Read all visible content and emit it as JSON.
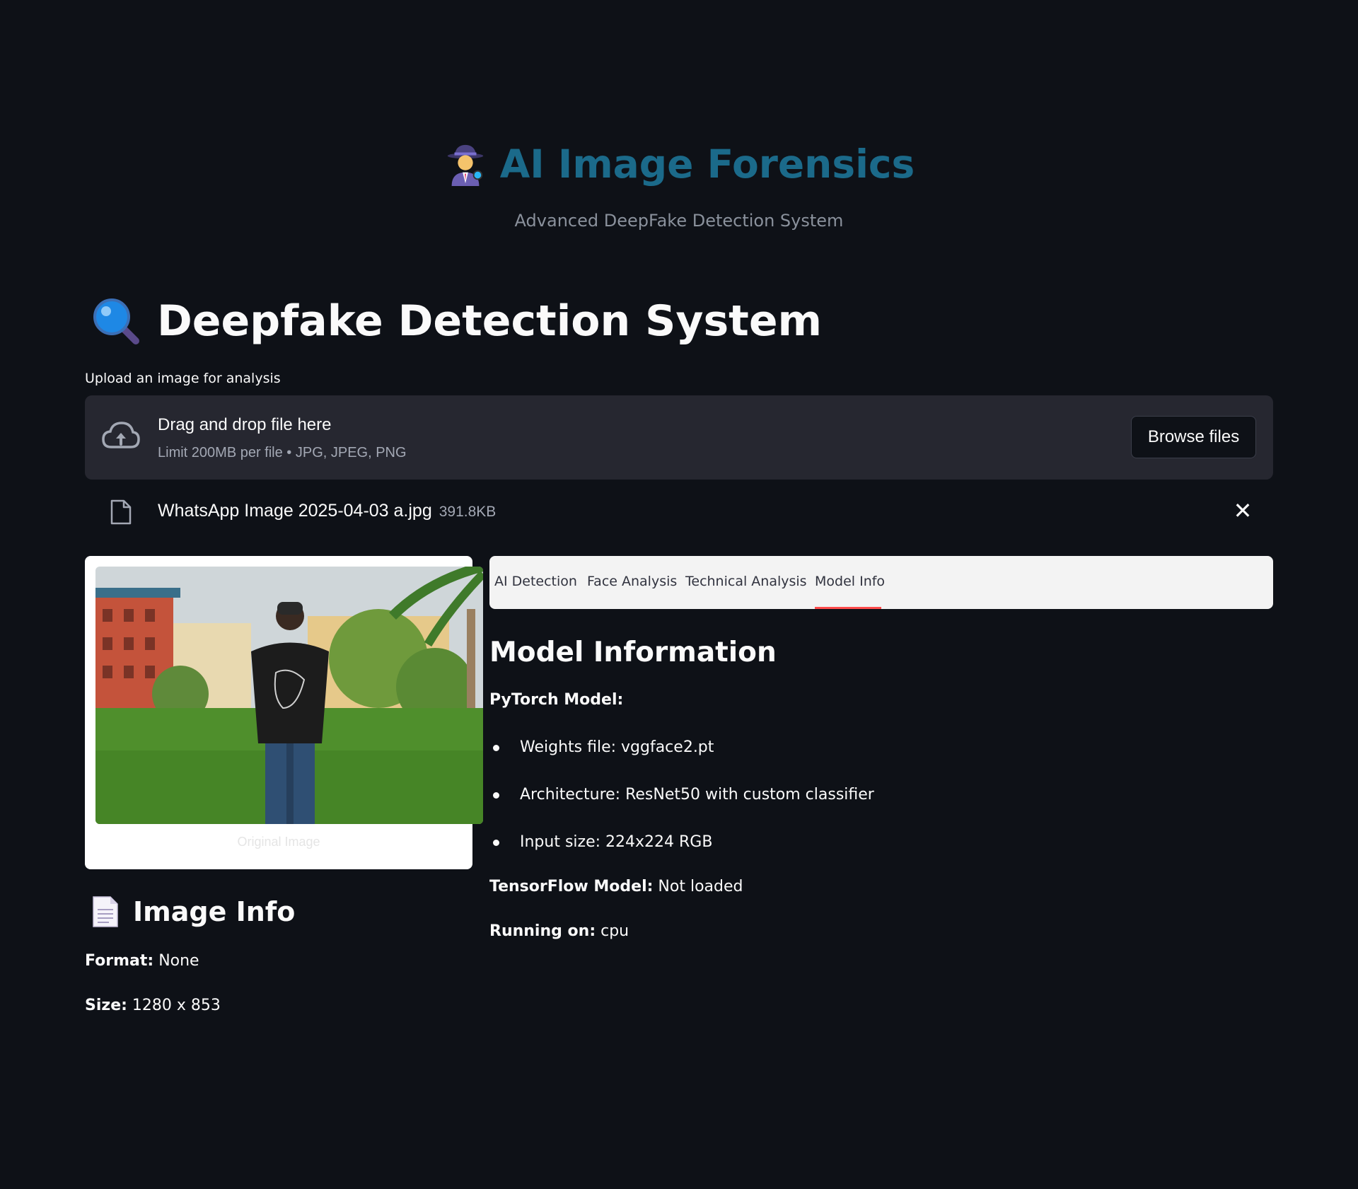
{
  "header": {
    "title": "AI Image Forensics",
    "subtitle": "Advanced DeepFake Detection System"
  },
  "page_title": "Deepfake Detection System",
  "uploader": {
    "label": "Upload an image for analysis",
    "drag_text": "Drag and drop file here",
    "limit_text": "Limit 200MB per file • JPG, JPEG, PNG",
    "browse_label": "Browse files"
  },
  "uploaded_file": {
    "name": "WhatsApp Image 2025-04-03 a.jpg",
    "size": "391.8KB"
  },
  "image_panel": {
    "caption": "Original Image"
  },
  "image_info": {
    "title": "Image Info",
    "format_label": "Format:",
    "format_value": "None",
    "size_label": "Size:",
    "size_value": "1280 x 853"
  },
  "tabs": [
    {
      "label": "AI Detection"
    },
    {
      "label": "Face Analysis"
    },
    {
      "label": "Technical Analysis"
    },
    {
      "label": "Model Info",
      "active": true
    }
  ],
  "model_info": {
    "title": "Model Information",
    "pytorch_label": "PyTorch Model:",
    "items": [
      "Weights file: vggface2.pt",
      "Architecture: ResNet50 with custom classifier",
      "Input size: 224x224 RGB"
    ],
    "tensorflow_label": "TensorFlow Model:",
    "tensorflow_value": "Not loaded",
    "running_label": "Running on:",
    "running_value": "cpu"
  },
  "colors": {
    "background": "#0e1117",
    "header_title": "#1b6a8a",
    "tab_active_underline": "#ff4b4b",
    "dropzone": "#262730"
  }
}
